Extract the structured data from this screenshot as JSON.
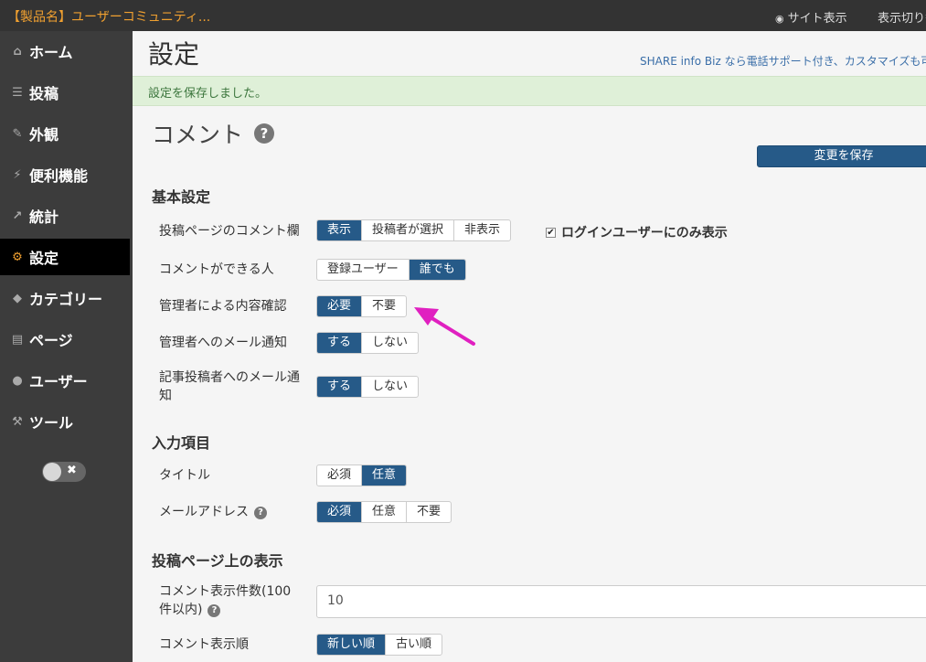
{
  "topbar": {
    "brand": "【製品名】ユーザーコミュニティ...",
    "site_view": "サイト表示",
    "view_switch": "表示切り替"
  },
  "sidebar": {
    "items": [
      {
        "label": "ホーム",
        "icon": "home-icon"
      },
      {
        "label": "投稿",
        "icon": "list-icon"
      },
      {
        "label": "外観",
        "icon": "brush-icon"
      },
      {
        "label": "便利機能",
        "icon": "plug-icon"
      },
      {
        "label": "統計",
        "icon": "chart-icon"
      },
      {
        "label": "設定",
        "icon": "gears-icon"
      },
      {
        "label": "カテゴリー",
        "icon": "tags-icon"
      },
      {
        "label": "ページ",
        "icon": "page-icon"
      },
      {
        "label": "ユーザー",
        "icon": "users-icon"
      },
      {
        "label": "ツール",
        "icon": "wrench-icon"
      }
    ],
    "active_index": 5
  },
  "header": {
    "title": "設定",
    "promo": "SHARE info Biz なら電話サポート付き、カスタマイズも可"
  },
  "notice": "設定を保存しました。",
  "section": {
    "title": "コメント",
    "save_label": "変更を保存"
  },
  "basic": {
    "heading": "基本設定",
    "comment_field": {
      "label": "投稿ページのコメント欄",
      "options": [
        "表示",
        "投稿者が選択",
        "非表示"
      ],
      "selected": "表示"
    },
    "login_only": {
      "label": "ログインユーザーにのみ表示",
      "checked": true
    },
    "who_can_comment": {
      "label": "コメントができる人",
      "options": [
        "登録ユーザー",
        "誰でも"
      ],
      "selected": "誰でも"
    },
    "admin_review": {
      "label": "管理者による内容確認",
      "options": [
        "必要",
        "不要"
      ],
      "selected": "必要"
    },
    "admin_mail": {
      "label": "管理者へのメール通知",
      "options": [
        "する",
        "しない"
      ],
      "selected": "する"
    },
    "author_mail": {
      "label1": "記事投稿者へのメール通",
      "label2": "知",
      "options": [
        "する",
        "しない"
      ],
      "selected": "する"
    }
  },
  "inputs": {
    "heading": "入力項目",
    "title_field": {
      "label": "タイトル",
      "options": [
        "必須",
        "任意"
      ],
      "selected": "任意"
    },
    "mail_field": {
      "label": "メールアドレス",
      "options": [
        "必須",
        "任意",
        "不要"
      ],
      "selected": "必須"
    }
  },
  "display": {
    "heading": "投稿ページ上の表示",
    "count": {
      "label1": "コメント表示件数(100",
      "label2": "件以内)",
      "value": "10"
    },
    "order": {
      "label": "コメント表示順",
      "options": [
        "新しい順",
        "古い順"
      ],
      "selected": "新しい順"
    }
  },
  "colors": {
    "accent": "#265a88",
    "annotation_arrow": "#e020c0"
  }
}
